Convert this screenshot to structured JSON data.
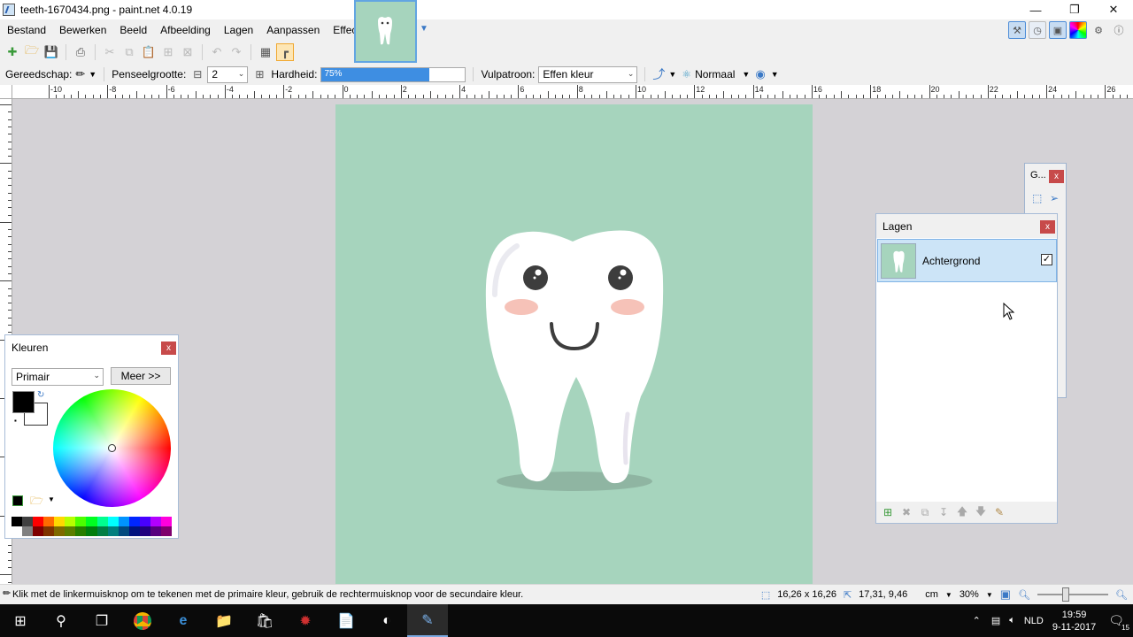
{
  "window": {
    "title": "teeth-1670434.png - paint.net 4.0.19"
  },
  "menu": [
    "Bestand",
    "Bewerken",
    "Beeld",
    "Afbeelding",
    "Lagen",
    "Aanpassen",
    "Effecten"
  ],
  "toolbar2": {
    "tool_label": "Gereedschap:",
    "brush_size_label": "Penseelgrootte:",
    "brush_size_value": "2",
    "hardness_label": "Hardheid:",
    "hardness_value": "75%",
    "hardness_fraction": 0.75,
    "fill_label": "Vulpatroon:",
    "fill_value": "Effen kleur",
    "blend_value": "Normaal"
  },
  "ruler": {
    "labels": [
      "-10",
      "-8",
      "-6",
      "-4",
      "-2",
      "0",
      "2",
      "4",
      "6",
      "8",
      "10",
      "12",
      "14",
      "16",
      "18",
      "20",
      "22",
      "24",
      "26"
    ]
  },
  "tools_window": {
    "title": "G..."
  },
  "layers_window": {
    "title": "Lagen",
    "layers": [
      {
        "name": "Achtergrond",
        "visible": true
      }
    ]
  },
  "colors_window": {
    "title": "Kleuren",
    "mode": "Primair",
    "more_button": "Meer >>",
    "primary_color": "#000000",
    "secondary_color": "#ffffff",
    "palette": [
      "#000000",
      "#404040",
      "#ff0000",
      "#ff6a00",
      "#ffd800",
      "#b6ff00",
      "#4cff00",
      "#00ff21",
      "#00ff90",
      "#00ffff",
      "#0094ff",
      "#0026ff",
      "#4800ff",
      "#b200ff",
      "#ff00dc",
      "#ffffff",
      "#808080",
      "#7f0000",
      "#7f3300",
      "#7f6a00",
      "#5b7f00",
      "#267f00",
      "#007f0e",
      "#007f46",
      "#007f7f",
      "#004a7f",
      "#00137f",
      "#21007f",
      "#57007f",
      "#7f006e"
    ]
  },
  "status": {
    "hint": "Klik met de linkermuisknop om te tekenen met de primaire kleur, gebruik de rechtermuisknop voor de secundaire kleur.",
    "selection_size": "16,26 x 16,26",
    "cursor_pos": "17,31, 9,46",
    "unit": "cm",
    "zoom": "30%"
  },
  "taskbar": {
    "lang": "NLD",
    "time": "19:59",
    "date": "9-11-2017",
    "notifications": "15"
  },
  "colors": {
    "canvas_bg": "#a6d4bd",
    "workspace_bg": "#d4d2d6",
    "accent": "#3e8ee2"
  }
}
